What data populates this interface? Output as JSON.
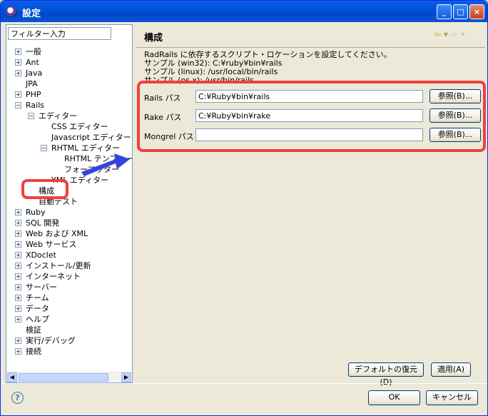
{
  "window": {
    "title": "設定"
  },
  "filter": {
    "value": "フィルター入力"
  },
  "tree": [
    {
      "label": "一般",
      "indent": 0,
      "expander": "+"
    },
    {
      "label": "Ant",
      "indent": 0,
      "expander": "+"
    },
    {
      "label": "Java",
      "indent": 0,
      "expander": "+"
    },
    {
      "label": "JPA",
      "indent": 0,
      "expander": ""
    },
    {
      "label": "PHP",
      "indent": 0,
      "expander": "+"
    },
    {
      "label": "Rails",
      "indent": 0,
      "expander": "-"
    },
    {
      "label": "エディター",
      "indent": 1,
      "expander": "-"
    },
    {
      "label": "CSS エディター",
      "indent": 2,
      "expander": ""
    },
    {
      "label": "Javascript エディター",
      "indent": 2,
      "expander": ""
    },
    {
      "label": "RHTML エディター",
      "indent": 2,
      "expander": "-"
    },
    {
      "label": "RHTML テンプレート",
      "indent": 3,
      "expander": ""
    },
    {
      "label": "フォーマッター",
      "indent": 3,
      "expander": ""
    },
    {
      "label": "YML エディター",
      "indent": 2,
      "expander": ""
    },
    {
      "label": "構成",
      "indent": 1,
      "expander": ""
    },
    {
      "label": "自動テスト",
      "indent": 1,
      "expander": ""
    },
    {
      "label": "Ruby",
      "indent": 0,
      "expander": "+"
    },
    {
      "label": "SQL 開発",
      "indent": 0,
      "expander": "+"
    },
    {
      "label": "Web および XML",
      "indent": 0,
      "expander": "+"
    },
    {
      "label": "Web サービス",
      "indent": 0,
      "expander": "+"
    },
    {
      "label": "XDoclet",
      "indent": 0,
      "expander": "+"
    },
    {
      "label": "インストール/更新",
      "indent": 0,
      "expander": "+"
    },
    {
      "label": "インターネット",
      "indent": 0,
      "expander": "+"
    },
    {
      "label": "サーバー",
      "indent": 0,
      "expander": "+"
    },
    {
      "label": "チーム",
      "indent": 0,
      "expander": "+"
    },
    {
      "label": "データ",
      "indent": 0,
      "expander": "+"
    },
    {
      "label": "ヘルプ",
      "indent": 0,
      "expander": "+"
    },
    {
      "label": "検証",
      "indent": 0,
      "expander": ""
    },
    {
      "label": "実行/デバッグ",
      "indent": 0,
      "expander": "+"
    },
    {
      "label": "接続",
      "indent": 0,
      "expander": "+"
    }
  ],
  "page": {
    "title": "構成",
    "description": [
      "RadRails に依存するスクリプト・ロケーションを設定してください。",
      "サンプル (win32): C:¥ruby¥bin¥rails",
      "サンプル (linux): /usr/local/bin/rails",
      "サンプル (os x): /usr/bin/rails"
    ],
    "fields": [
      {
        "label": "Rails パス",
        "value": "C:¥Ruby¥bin¥rails",
        "button": "参照(B)..."
      },
      {
        "label": "Rake パス",
        "value": "C:¥Ruby¥bin¥rake",
        "button": "参照(B)..."
      },
      {
        "label": "Mongrel パス",
        "value": "",
        "button": "参照(B)..."
      }
    ],
    "restore_defaults": "デフォルトの復元(D)",
    "apply": "適用(A)"
  },
  "footer": {
    "ok": "OK",
    "cancel": "キャンセル"
  },
  "colors": {
    "highlight": "#f04040",
    "titlebar": "#0054e3",
    "arrow": "#3344dd"
  }
}
